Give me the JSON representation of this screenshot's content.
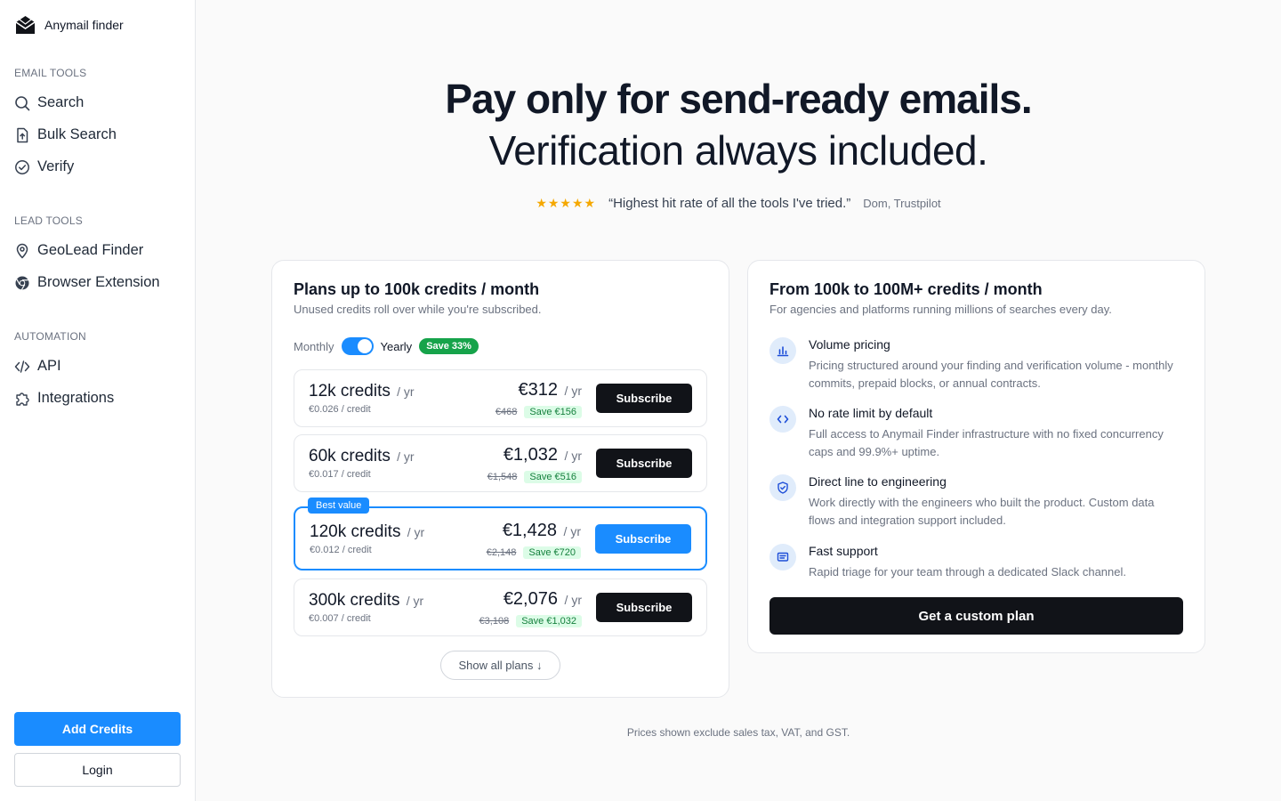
{
  "brand": {
    "name": "Anymail finder",
    "icon": "envelope-logo-icon"
  },
  "sidebar": {
    "sections": [
      {
        "label": "EMAIL TOOLS",
        "items": [
          {
            "label": "Search",
            "icon": "search-icon"
          },
          {
            "label": "Bulk Search",
            "icon": "file-upload-icon"
          },
          {
            "label": "Verify",
            "icon": "check-circle-icon"
          }
        ]
      },
      {
        "label": "LEAD TOOLS",
        "items": [
          {
            "label": "GeoLead Finder",
            "icon": "map-pin-icon"
          },
          {
            "label": "Browser Extension",
            "icon": "chrome-icon"
          }
        ]
      },
      {
        "label": "AUTOMATION",
        "items": [
          {
            "label": "API",
            "icon": "code-icon"
          },
          {
            "label": "Integrations",
            "icon": "puzzle-icon"
          }
        ]
      }
    ],
    "add_credits": "Add Credits",
    "login": "Login"
  },
  "hero": {
    "line1": "Pay only for send-ready emails.",
    "line2": "Verification always included.",
    "stars": "★★★★★",
    "quote": "“Highest hit rate of all the tools I've tried.”",
    "author": "Dom, Trustpilot"
  },
  "plans_card": {
    "title": "Plans up to 100k credits / month",
    "subtitle": "Unused credits roll over while you're subscribed.",
    "monthly": "Monthly",
    "yearly": "Yearly",
    "yearly_selected": true,
    "save_badge": "Save 33%",
    "plans": [
      {
        "credits": "12k credits",
        "period": "/ yr",
        "per_credit": "€0.026 / credit",
        "price": "€312",
        "old": "€468",
        "save": "Save €156",
        "button": "Subscribe",
        "best": false
      },
      {
        "credits": "60k credits",
        "period": "/ yr",
        "per_credit": "€0.017 / credit",
        "price": "€1,032",
        "old": "€1,548",
        "save": "Save €516",
        "button": "Subscribe",
        "best": false
      },
      {
        "credits": "120k credits",
        "period": "/ yr",
        "per_credit": "€0.012 / credit",
        "price": "€1,428",
        "old": "€2,148",
        "save": "Save €720",
        "button": "Subscribe",
        "best": true,
        "badge": "Best value"
      },
      {
        "credits": "300k credits",
        "period": "/ yr",
        "per_credit": "€0.007 / credit",
        "price": "€2,076",
        "old": "€3,108",
        "save": "Save €1,032",
        "button": "Subscribe",
        "best": false
      }
    ],
    "show_all": "Show all plans ↓"
  },
  "custom_card": {
    "title": "From 100k to 100M+ credits / month",
    "subtitle": "For agencies and platforms running millions of searches every day.",
    "features": [
      {
        "icon": "bar-chart-icon",
        "title": "Volume pricing",
        "desc": "Pricing structured around your finding and verification volume - monthly commits, prepaid blocks, or annual contracts."
      },
      {
        "icon": "code-icon",
        "title": "No rate limit by default",
        "desc": "Full access to Anymail Finder infrastructure with no fixed concurrency caps and 99.9%+ uptime."
      },
      {
        "icon": "shield-check-icon",
        "title": "Direct line to engineering",
        "desc": "Work directly with the engineers who built the product. Custom data flows and integration support included."
      },
      {
        "icon": "message-icon",
        "title": "Fast support",
        "desc": "Rapid triage for your team through a dedicated Slack channel."
      }
    ],
    "cta": "Get a custom plan"
  },
  "footnote": "Prices shown exclude sales tax, VAT, and GST.",
  "colors": {
    "accent": "#1a8cff",
    "dark_button": "#111318",
    "save_green": "#16a34a",
    "star": "#f5a800"
  }
}
